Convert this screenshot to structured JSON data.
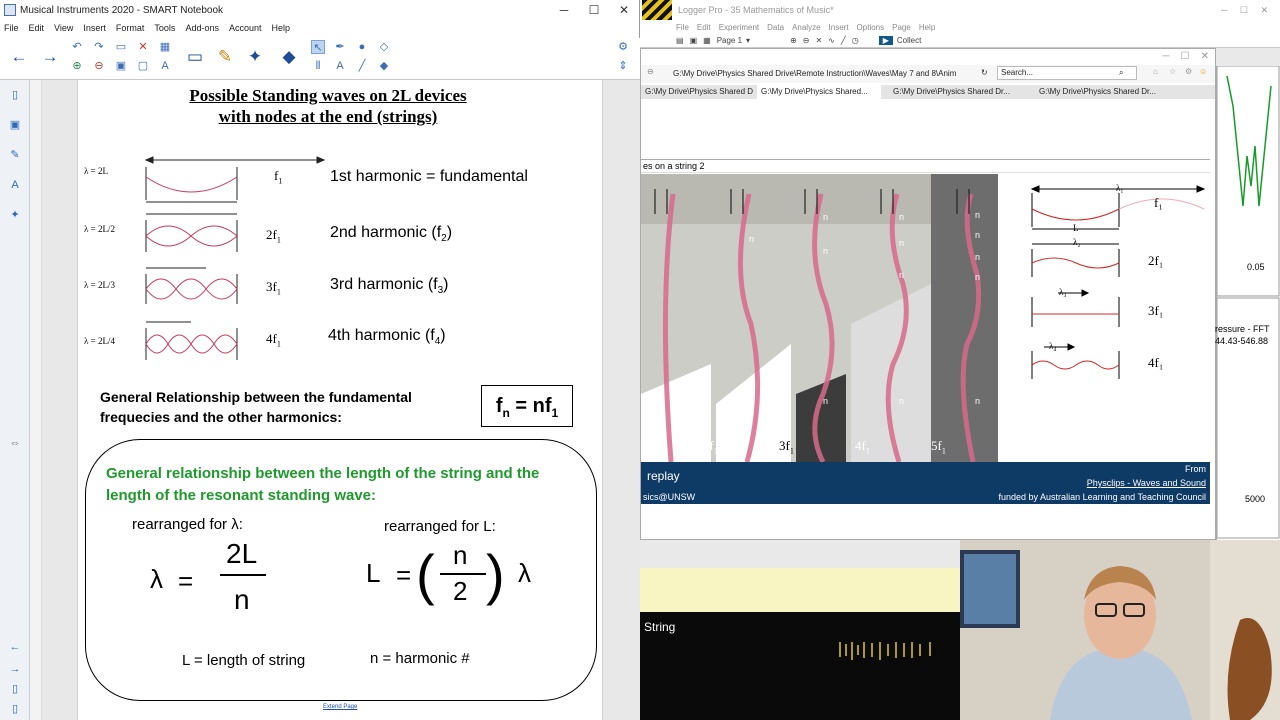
{
  "smart": {
    "window_title": "Musical Instruments 2020 - SMART Notebook",
    "menu": [
      "File",
      "Edit",
      "View",
      "Insert",
      "Format",
      "Tools",
      "Add-ons",
      "Account",
      "Help"
    ],
    "page": {
      "title_line1": "Possible Standing waves on 2L devices",
      "title_line2": "with nodes at the end (strings)",
      "harmonics": [
        {
          "lambda": "λ = 2L",
          "freq": "f",
          "freq_sub": "1",
          "label": "1st harmonic = fundamental",
          "label_sub": "",
          "label_after": ""
        },
        {
          "lambda": "λ = 2L/2",
          "freq": "2f",
          "freq_sub": "1",
          "label": "2nd harmonic (f",
          "label_sub": "2",
          "label_after": ")"
        },
        {
          "lambda": "λ = 2L/3",
          "freq": "3f",
          "freq_sub": "1",
          "label": "3rd harmonic (f",
          "label_sub": "3",
          "label_after": ")"
        },
        {
          "lambda": "λ = 2L/4",
          "freq": "4f",
          "freq_sub": "1",
          "label": "4th harmonic (f",
          "label_sub": "4",
          "label_after": ")"
        }
      ],
      "general_rel": "General Relationship between the fundamental frequecies and the other harmonics:",
      "formula_box": {
        "lhs": "f",
        "lhs_sub": "n",
        "eq": " = nf",
        "rhs_sub": "1"
      },
      "green_heading": "General relationship between the length of the string and the length of the resonant standing wave:",
      "rearranged_lambda": "rearranged for λ:",
      "rearranged_L": "rearranged for L:",
      "lambda_sym": "λ",
      "equals": "=",
      "num_2L": "2L",
      "den_n": "n",
      "L_sym": "L",
      "paren_n": "n",
      "paren_2": "2",
      "legend_L": "L = length of string",
      "legend_n": "n = harmonic #",
      "extend_page": "Extend Page"
    }
  },
  "logger": {
    "window_title": "Logger Pro - 35 Mathematics of Music*",
    "menu": [
      "File",
      "Edit",
      "Experiment",
      "Data",
      "Analyze",
      "Insert",
      "Options",
      "Page",
      "Help"
    ],
    "page_select": "Page 1",
    "collect": "Collect",
    "graph_label_005": "0.05",
    "fft_label": "ressure - FFT",
    "fft_range": "44.43-546.88",
    "axis_5000": "5000",
    "string_label": "String"
  },
  "browser": {
    "address": "G:\\My Drive\\Physics Shared Drive\\Remote Instruction\\Waves\\May 7 and 8\\Anim",
    "search_placeholder": "Search...",
    "tabs": [
      "G:\\My Drive\\Physics Shared Dr...",
      "G:\\My Drive\\Physics Shared...",
      "G:\\My Drive\\Physics Shared Dr...",
      "G:\\My Drive\\Physics Shared Dr..."
    ],
    "heading_fragment": "es on a string 2",
    "video_labels": [
      "2f",
      "3f",
      "4f",
      "5f"
    ],
    "video_label_sub": "1",
    "node_label": "n",
    "right_diagram": {
      "lambda1": "λ₁",
      "f1": "f₁",
      "L": "L",
      "lambda2": "λ₂",
      "f2": "2f₁",
      "lambda3": "λ₃",
      "f3": "3f₁",
      "lambda4": "λ₄",
      "f4": "4f₁"
    },
    "replay": "replay",
    "from": "From",
    "physclips": "Physclips - Waves and Sound",
    "unsw": "sics@UNSW",
    "funded": "funded by Australian Learning and Teaching Council"
  },
  "colors": {
    "green_heading": "#1f9a2d",
    "wave_pink": "#c83a5c",
    "footer_blue": "#0e3a66",
    "collect_btn": "#0f5a8a"
  }
}
